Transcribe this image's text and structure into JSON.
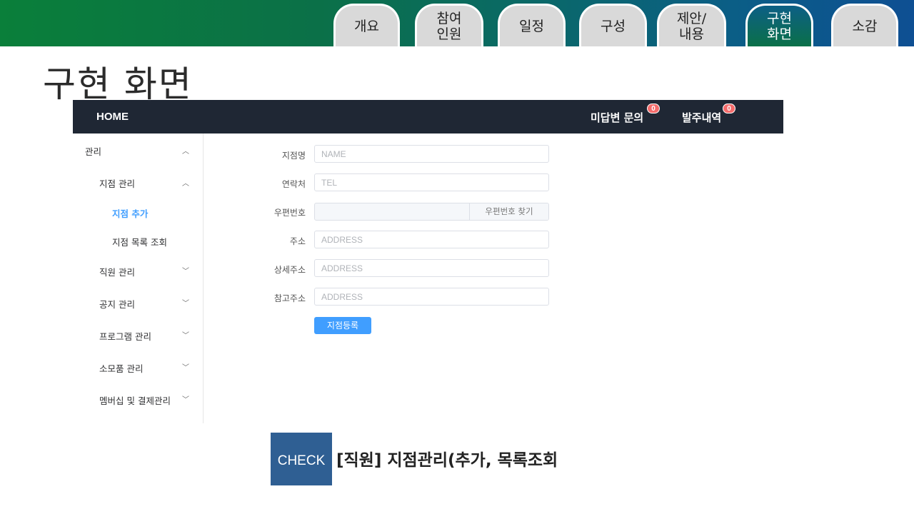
{
  "nav_tabs": [
    {
      "label": "개요"
    },
    {
      "label": "참여\n인원"
    },
    {
      "label": "일정"
    },
    {
      "label": "구성"
    },
    {
      "label": "제안/\n내용"
    },
    {
      "label": "구현\n화면",
      "active": true
    },
    {
      "label": "소감"
    }
  ],
  "slide_title": "구현 화면",
  "app": {
    "home": "HOME",
    "header_links": [
      {
        "label": "미답변 문의",
        "badge": "0"
      },
      {
        "label": "발주내역",
        "badge": "0"
      }
    ],
    "sidebar": [
      {
        "label": "관리",
        "chevron": "up"
      },
      {
        "label": "지점 관리",
        "chevron": "up"
      },
      {
        "label": "지점 추가",
        "active": true
      },
      {
        "label": "지점 목록 조회"
      },
      {
        "label": "직원 관리",
        "chevron": "down"
      },
      {
        "label": "공지 관리",
        "chevron": "down"
      },
      {
        "label": "프로그램 관리",
        "chevron": "down"
      },
      {
        "label": "소모품 관리",
        "chevron": "down"
      },
      {
        "label": "멤버십 및 결제관리",
        "chevron": "down"
      }
    ],
    "form": {
      "name": {
        "label": "지점명",
        "placeholder": "NAME"
      },
      "tel": {
        "label": "연락처",
        "placeholder": "TEL"
      },
      "postal": {
        "label": "우편번호",
        "button": "우편번호 찾기"
      },
      "address": {
        "label": "주소",
        "placeholder": "ADDRESS"
      },
      "detail_address": {
        "label": "상세주소",
        "placeholder": "ADDRESS"
      },
      "ref_address": {
        "label": "참고주소",
        "placeholder": "ADDRESS"
      },
      "submit": "지점등록"
    }
  },
  "check": {
    "badge": "CHECK",
    "text": "[직원] 지점관리(추가, 목록조회"
  },
  "colors": {
    "header_bg": "#1f2734",
    "accent": "#409eff",
    "badge": "#f56c6c",
    "check_bg": "#2f5f93"
  }
}
